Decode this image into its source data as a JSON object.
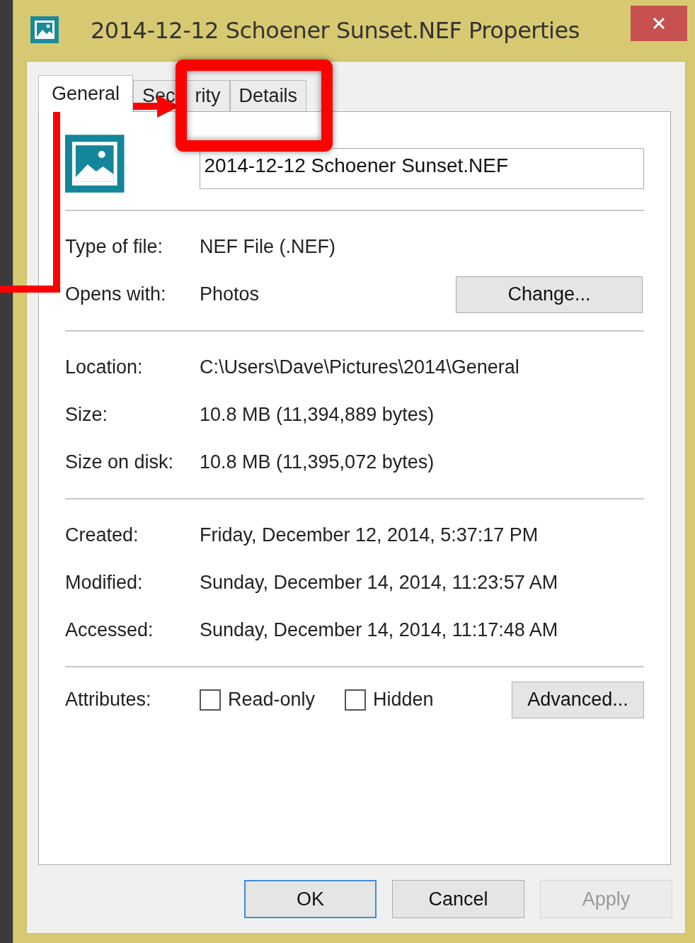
{
  "window": {
    "title": "2014-12-12 Schoener Sunset.NEF Properties"
  },
  "tabs": [
    {
      "label": "General",
      "selected": true
    },
    {
      "label": "Sec",
      "label_end": "rity",
      "selected": false
    },
    {
      "label": "Details",
      "selected": false
    }
  ],
  "file_name": "2014-12-12 Schoener Sunset.NEF",
  "sections": [
    {
      "rows": [
        {
          "label": "Type of file:",
          "value": "NEF File (.NEF)"
        },
        {
          "label": "Opens with:",
          "value": "Photos",
          "button": "Change..."
        }
      ]
    },
    {
      "rows": [
        {
          "label": "Location:",
          "value": "C:\\Users\\Dave\\Pictures\\2014\\General"
        },
        {
          "label": "Size:",
          "value": "10.8 MB (11,394,889 bytes)"
        },
        {
          "label": "Size on disk:",
          "value": "10.8 MB (11,395,072 bytes)"
        }
      ]
    },
    {
      "rows": [
        {
          "label": "Created:",
          "value": "Friday, December 12, 2014, 5:37:17 PM"
        },
        {
          "label": "Modified:",
          "value": "Sunday, December 14, 2014, 11:23:57 AM"
        },
        {
          "label": "Accessed:",
          "value": "Sunday, December 14, 2014, 11:17:48 AM"
        }
      ]
    }
  ],
  "attributes": {
    "label": "Attributes:",
    "checkboxes": [
      {
        "label": "Read-only",
        "checked": false
      },
      {
        "label": "Hidden",
        "checked": false
      }
    ],
    "button": "Advanced..."
  },
  "buttons": [
    {
      "label": "OK",
      "default": true,
      "disabled": false
    },
    {
      "label": "Cancel",
      "default": false,
      "disabled": false
    },
    {
      "label": "Apply",
      "default": false,
      "disabled": true
    }
  ]
}
